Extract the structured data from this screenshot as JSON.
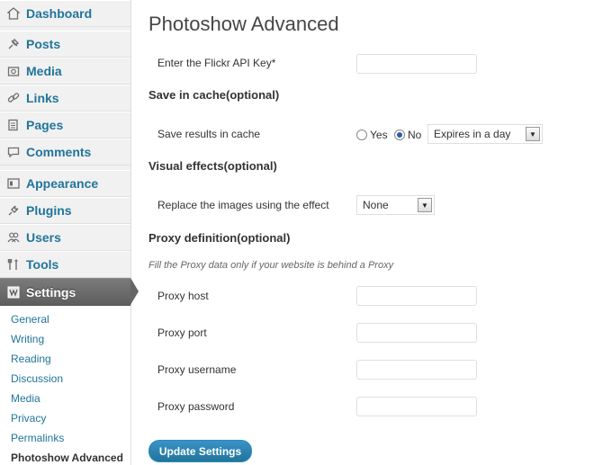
{
  "sidebar": {
    "items": [
      {
        "label": "Dashboard",
        "icon": "dashboard-icon"
      },
      {
        "label": "Posts",
        "icon": "pushpin-icon"
      },
      {
        "label": "Media",
        "icon": "media-icon"
      },
      {
        "label": "Links",
        "icon": "link-icon"
      },
      {
        "label": "Pages",
        "icon": "pages-icon"
      },
      {
        "label": "Comments",
        "icon": "comment-icon"
      },
      {
        "label": "Appearance",
        "icon": "appearance-icon"
      },
      {
        "label": "Plugins",
        "icon": "plug-icon"
      },
      {
        "label": "Users",
        "icon": "users-icon"
      },
      {
        "label": "Tools",
        "icon": "tools-icon"
      },
      {
        "label": "Settings",
        "icon": "settings-icon",
        "active": true
      }
    ],
    "submenu": [
      "General",
      "Writing",
      "Reading",
      "Discussion",
      "Media",
      "Privacy",
      "Permalinks",
      "Photoshow Advanced"
    ],
    "current_submenu": "Photoshow Advanced"
  },
  "page": {
    "title": "Photoshow Advanced",
    "api_key_label": "Enter the Flickr API Key*",
    "api_key_value": "",
    "cache_section": "Save in cache(optional)",
    "cache_label": "Save results in cache",
    "radio_yes": "Yes",
    "radio_no": "No",
    "radio_selected": "No",
    "cache_expiry": "Expires in a day",
    "effects_section": "Visual effects(optional)",
    "effect_label": "Replace the images using the effect",
    "effect_value": "None",
    "proxy_section": "Proxy definition(optional)",
    "proxy_description": "Fill the Proxy data only if your website is behind a Proxy",
    "proxy_host_label": "Proxy host",
    "proxy_port_label": "Proxy port",
    "proxy_username_label": "Proxy username",
    "proxy_password_label": "Proxy password",
    "submit_label": "Update Settings"
  },
  "colors": {
    "link": "#21759b",
    "active_menu": "#6d6d6d",
    "button": "#21759b"
  }
}
